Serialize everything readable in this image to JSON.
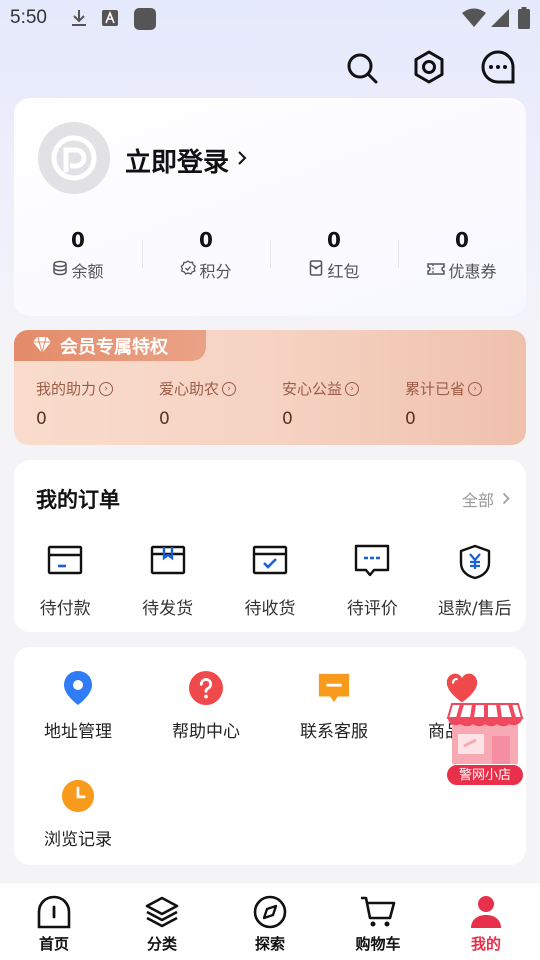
{
  "status_bar": {
    "time": "5:50"
  },
  "profile": {
    "login_label": "立即登录",
    "stats": [
      {
        "value": "0",
        "label": "余额",
        "icon": "coins-icon"
      },
      {
        "value": "0",
        "label": "积分",
        "icon": "badge-icon"
      },
      {
        "value": "0",
        "label": "红包",
        "icon": "red-packet-icon"
      },
      {
        "value": "0",
        "label": "优惠券",
        "icon": "coupon-icon"
      }
    ]
  },
  "vip": {
    "title": "会员专属特权",
    "items": [
      {
        "label": "我的助力",
        "value": "0"
      },
      {
        "label": "爱心助农",
        "value": "0"
      },
      {
        "label": "安心公益",
        "value": "0"
      },
      {
        "label": "累计已省",
        "value": "0"
      }
    ]
  },
  "orders": {
    "title": "我的订单",
    "all_label": "全部",
    "items": [
      {
        "label": "待付款",
        "icon": "wallet-icon"
      },
      {
        "label": "待发货",
        "icon": "package-icon"
      },
      {
        "label": "待收货",
        "icon": "box-check-icon"
      },
      {
        "label": "待评价",
        "icon": "comment-icon"
      },
      {
        "label": "退款/售后",
        "icon": "shield-yen-icon"
      }
    ]
  },
  "services": [
    {
      "label": "地址管理",
      "icon": "location-pin-icon",
      "color": "#2f7cf6"
    },
    {
      "label": "帮助中心",
      "icon": "question-icon",
      "color": "#f0494b"
    },
    {
      "label": "联系客服",
      "icon": "chat-icon",
      "color": "#f89a1c"
    },
    {
      "label": "商品收藏",
      "icon": "heart-icon",
      "color": "#f0494b"
    },
    {
      "label": "浏览记录",
      "icon": "clock-icon",
      "color": "#f89a1c"
    }
  ],
  "float_shop": {
    "label": "警网小店"
  },
  "tabbar": [
    {
      "label": "首页",
      "icon": "home-icon",
      "active": false
    },
    {
      "label": "分类",
      "icon": "layers-icon",
      "active": false
    },
    {
      "label": "探索",
      "icon": "compass-icon",
      "active": false
    },
    {
      "label": "购物车",
      "icon": "cart-icon",
      "active": false
    },
    {
      "label": "我的",
      "icon": "user-icon",
      "active": true
    }
  ],
  "colors": {
    "accent": "#e8304a",
    "vip_tag": "#e48b69",
    "vip_bg": "#f6d3c3"
  }
}
